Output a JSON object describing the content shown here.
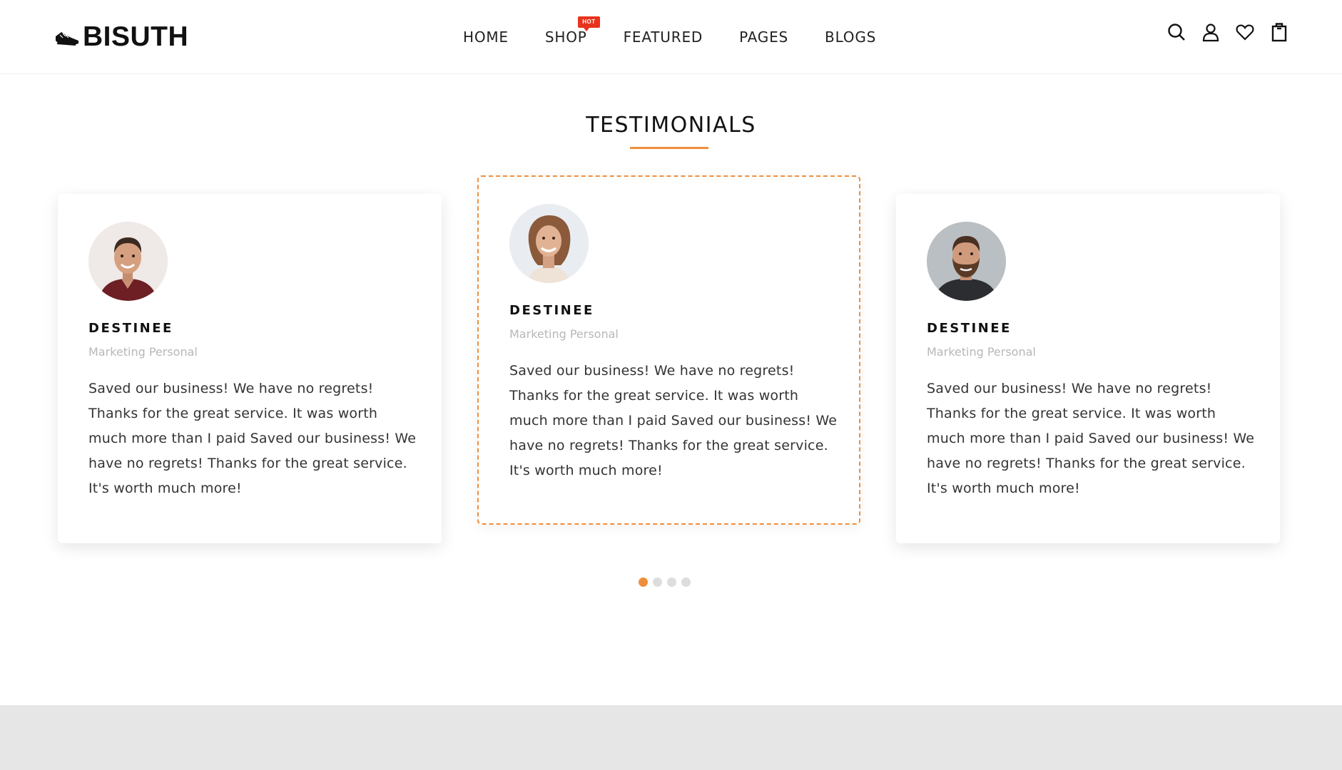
{
  "brand": {
    "logo_text": "BISUTH"
  },
  "nav": {
    "items": [
      {
        "label": "HOME"
      },
      {
        "label": "SHOP",
        "badge": "HOT"
      },
      {
        "label": "FEATURED"
      },
      {
        "label": "PAGES"
      },
      {
        "label": "BLOGS"
      }
    ]
  },
  "header_icons": [
    "search-icon",
    "user-icon",
    "heart-icon",
    "shopping-bag-icon"
  ],
  "section": {
    "title": "TESTIMONIALS"
  },
  "testimonials": [
    {
      "name": "DESTINEE",
      "role": "Marketing Personal",
      "quote": "Saved our business! We have no regrets! Thanks for the great service. It was worth much more than I paid Saved our business! We have no regrets! Thanks for the great service. It's worth much more!"
    },
    {
      "name": "DESTINEE",
      "role": "Marketing Personal",
      "quote": "Saved our business! We have no regrets! Thanks for the great service. It was worth much more than I paid Saved our business! We have no regrets! Thanks for the great service. It's worth much more!"
    },
    {
      "name": "DESTINEE",
      "role": "Marketing Personal",
      "quote": "Saved our business! We have no regrets! Thanks for the great service. It was worth much more than I paid Saved our business! We have no regrets! Thanks for the great service. It's worth much more!"
    }
  ],
  "carousel": {
    "total_pages": 4,
    "active_page": 1
  },
  "colors": {
    "accent": "#ef8e3d",
    "hot_badge": "#e8331d",
    "footer_band": "#e6e6e6"
  }
}
